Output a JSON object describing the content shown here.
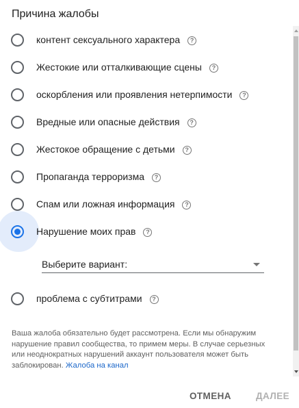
{
  "dialog": {
    "title": "Причина жалобы",
    "options": [
      {
        "label": "контент сексуального характера",
        "checked": false
      },
      {
        "label": "Жестокие или отталкивающие сцены",
        "checked": false
      },
      {
        "label": "оскорбления или проявления нетерпимости",
        "checked": false
      },
      {
        "label": "Вредные или опасные действия",
        "checked": false
      },
      {
        "label": "Жестокое обращение с детьми",
        "checked": false
      },
      {
        "label": "Пропаганда терроризма",
        "checked": false
      },
      {
        "label": "Спам или ложная информация",
        "checked": false
      },
      {
        "label": "Нарушение моих прав",
        "checked": true
      },
      {
        "label": "проблема с субтитрами",
        "checked": false
      }
    ],
    "help_glyph": "?",
    "select": {
      "value": "Выберите вариант:"
    },
    "notice": {
      "text": "Ваша жалоба обязательно будет рассмотрена. Если мы обнаружим нарушение правил сообщества, то примем меры. В случае серьезных или неоднократных нарушений аккаунт пользователя может быть заблокирован.",
      "link": "Жалоба на канал"
    },
    "buttons": {
      "cancel": "ОТМЕНА",
      "next": "ДАЛЕЕ"
    },
    "accent_color": "#1a73e8"
  }
}
